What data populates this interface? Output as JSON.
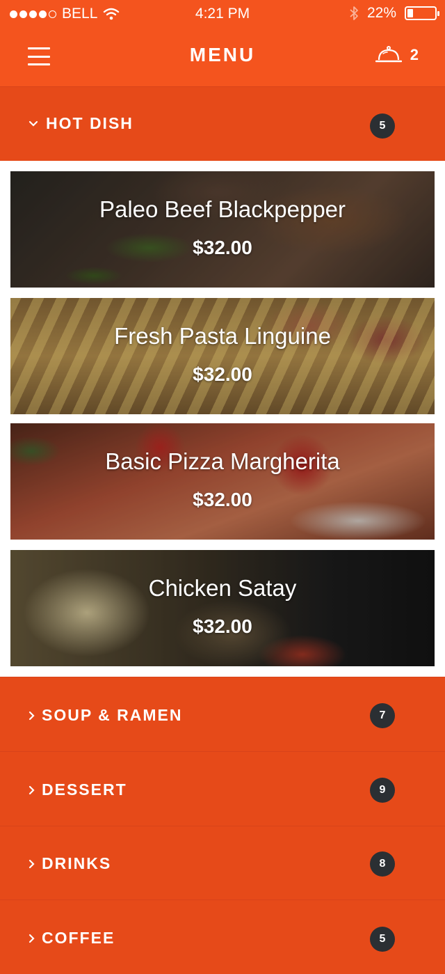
{
  "status_bar": {
    "carrier": "BELL",
    "time": "4:21 PM",
    "battery_percent": "22%",
    "battery_level": 0.22,
    "signal_bars_filled": 4,
    "signal_bars_total": 5
  },
  "nav": {
    "title": "MENU",
    "menu_icon": "hamburger-icon",
    "cart_icon": "service-bell-icon",
    "cart_count": "2"
  },
  "categories": [
    {
      "label": "HOT DISH",
      "count": "5",
      "expanded": true,
      "icon": "chevron-down-icon"
    },
    {
      "label": "SOUP & RAMEN",
      "count": "7",
      "expanded": false,
      "icon": "chevron-right-icon"
    },
    {
      "label": "DESSERT",
      "count": "9",
      "expanded": false,
      "icon": "chevron-right-icon"
    },
    {
      "label": "DRINKS",
      "count": "8",
      "expanded": false,
      "icon": "chevron-right-icon"
    },
    {
      "label": "COFFEE",
      "count": "5",
      "expanded": false,
      "icon": "chevron-right-icon"
    }
  ],
  "dishes": [
    {
      "name": "Paleo Beef Blackpepper",
      "price": "$32.00"
    },
    {
      "name": "Fresh Pasta Linguine",
      "price": "$32.00"
    },
    {
      "name": "Basic Pizza Margherita",
      "price": "$32.00"
    },
    {
      "name": "Chicken Satay",
      "price": "$32.00"
    }
  ],
  "colors": {
    "header": "#f4541e",
    "category": "#e64a19",
    "badge": "#2b2f33",
    "text": "#ffffff"
  }
}
